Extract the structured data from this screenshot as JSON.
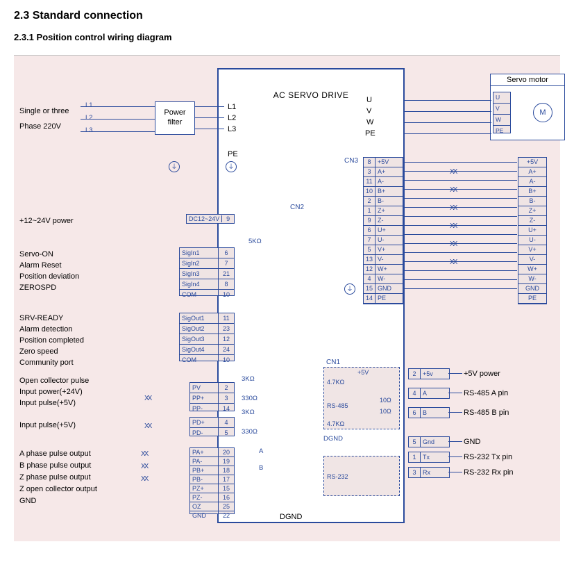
{
  "headings": {
    "section": "2.3 Standard connection",
    "subsection": "2.3.1 Position control wiring diagram"
  },
  "drive": {
    "title": "AC SERVO DRIVE",
    "dgnd": "DGND"
  },
  "power_input": {
    "source_label_1": "Single or three",
    "source_label_2": "Phase 220V",
    "lines": [
      "L1",
      "L2",
      "L3"
    ],
    "filter_label": "Power filter",
    "drive_terms": [
      "L1",
      "L2",
      "L3"
    ],
    "pe": "PE"
  },
  "dc_power": {
    "label": "+12~24V power",
    "range": "DC12~24V",
    "pin": "9"
  },
  "cn2_label": "CN2",
  "sig_in": {
    "resistor": "5KΩ",
    "labels": [
      "Servo-ON",
      "Alarm Reset",
      "Position deviation",
      "ZEROSPD"
    ],
    "rows": [
      {
        "name": "SigIn1",
        "pin": "6"
      },
      {
        "name": "SigIn2",
        "pin": "7"
      },
      {
        "name": "SigIn3",
        "pin": "21"
      },
      {
        "name": "SigIn4",
        "pin": "8"
      },
      {
        "name": "COM",
        "pin": "10"
      }
    ]
  },
  "sig_out": {
    "labels": [
      "SRV-READY",
      "Alarm detection",
      "Position completed",
      "Zero speed",
      "Community port"
    ],
    "rows": [
      {
        "name": "SigOut1",
        "pin": "11"
      },
      {
        "name": "SigOut2",
        "pin": "23"
      },
      {
        "name": "SigOut3",
        "pin": "12"
      },
      {
        "name": "SigOut4",
        "pin": "24"
      },
      {
        "name": "COM",
        "pin": "10"
      }
    ]
  },
  "pulse_in": {
    "labels": [
      "Open collector pulse",
      "Input power(+24V)",
      "Input pulse(+5V)",
      "",
      "Input pulse(+5V)"
    ],
    "r1": "3KΩ",
    "r2": "330Ω",
    "rows": [
      {
        "name": "PV",
        "pin": "2"
      },
      {
        "name": "PP+",
        "pin": "3"
      },
      {
        "name": "PP-",
        "pin": "14"
      },
      {
        "name": "PD+",
        "pin": "4"
      },
      {
        "name": "PD-",
        "pin": "5"
      }
    ]
  },
  "pulse_out": {
    "labels": [
      "A phase pulse output",
      "B phase pulse output",
      "Z phase pulse output",
      "Z open collector output",
      "GND"
    ],
    "rows": [
      {
        "name": "PA+",
        "pin": "20"
      },
      {
        "name": "PA-",
        "pin": "19"
      },
      {
        "name": "PB+",
        "pin": "18"
      },
      {
        "name": "PB-",
        "pin": "17"
      },
      {
        "name": "PZ+",
        "pin": "15"
      },
      {
        "name": "PZ-",
        "pin": "16"
      },
      {
        "name": "OZ",
        "pin": "25"
      },
      {
        "name": "GND",
        "pin": "22"
      }
    ],
    "phase_marks": [
      "A",
      "B"
    ]
  },
  "motor_power": {
    "drive_terms": [
      "U",
      "V",
      "W",
      "PE"
    ],
    "motor_title": "Servo motor",
    "motor_terms": [
      "U",
      "V",
      "W",
      "PE"
    ],
    "motor_symbol": "M"
  },
  "cn3": {
    "label": "CN3",
    "left_rows": [
      {
        "pin": "8",
        "name": "+5V"
      },
      {
        "pin": "3",
        "name": "A+"
      },
      {
        "pin": "11",
        "name": "A-"
      },
      {
        "pin": "10",
        "name": "B+"
      },
      {
        "pin": "2",
        "name": "B-"
      },
      {
        "pin": "1",
        "name": "Z+"
      },
      {
        "pin": "9",
        "name": "Z-"
      },
      {
        "pin": "6",
        "name": "U+"
      },
      {
        "pin": "7",
        "name": "U-"
      },
      {
        "pin": "5",
        "name": "V+"
      },
      {
        "pin": "13",
        "name": "V-"
      },
      {
        "pin": "12",
        "name": "W+"
      },
      {
        "pin": "4",
        "name": "W-"
      },
      {
        "pin": "15",
        "name": "GND"
      },
      {
        "pin": "14",
        "name": "PE"
      }
    ],
    "right_rows": [
      "+5V",
      "A+",
      "A-",
      "B+",
      "B-",
      "Z+",
      "Z-",
      "U+",
      "U-",
      "V+",
      "V-",
      "W+",
      "W-",
      "GND",
      "PE"
    ]
  },
  "cn1": {
    "label": "CN1",
    "v5": "+5V",
    "r": "4.7KΩ",
    "rs485": "RS-485",
    "rs232": "RS-232",
    "dgnd": "DGND",
    "rows": [
      {
        "pin": "2",
        "name": "+5v",
        "desc": "+5V power"
      },
      {
        "pin": "4",
        "name": "A",
        "desc": "RS-485 A pin"
      },
      {
        "pin": "6",
        "name": "B",
        "desc": "RS-485 B pin"
      },
      {
        "pin": "5",
        "name": "Gnd",
        "desc": "GND"
      },
      {
        "pin": "1",
        "name": "Tx",
        "desc": "RS-232 Tx pin"
      },
      {
        "pin": "3",
        "name": "Rx",
        "desc": "RS-232 Rx pin"
      }
    ],
    "r_ohm": "10Ω"
  }
}
